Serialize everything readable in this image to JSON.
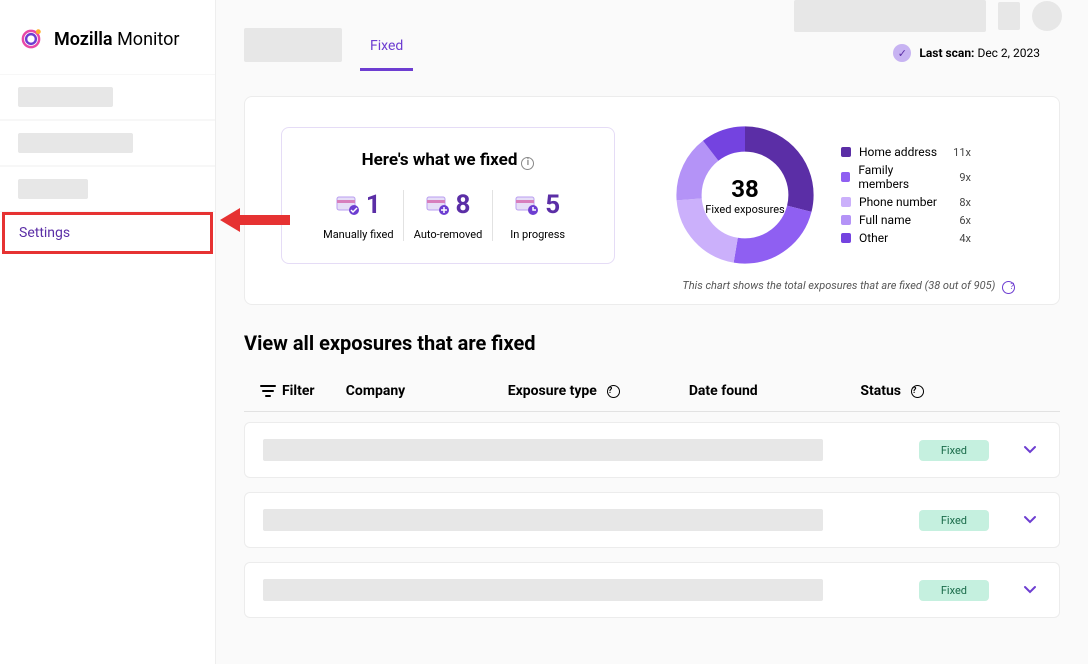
{
  "brand": {
    "name_part1": "Mozilla",
    "name_part2": "Monitor"
  },
  "sidebar": {
    "settings": "Settings"
  },
  "tabs": {
    "fixed": "Fixed"
  },
  "header": {
    "last_scan_label": "Last scan:",
    "last_scan_date": "Dec 2, 2023"
  },
  "summary": {
    "title": "Here's what we fixed",
    "stats": [
      {
        "value": "1",
        "label": "Manually fixed"
      },
      {
        "value": "8",
        "label": "Auto-removed"
      },
      {
        "value": "5",
        "label": "In progress"
      }
    ],
    "donut": {
      "value": "38",
      "label": "Fixed exposures"
    },
    "caption": "This chart shows the total exposures that are fixed (38 out of 905)"
  },
  "chart_data": {
    "type": "pie",
    "title": "Fixed exposures",
    "series": [
      {
        "name": "Home address",
        "value": 11,
        "color": "#5b2ea6"
      },
      {
        "name": "Family members",
        "value": 9,
        "color": "#8f5ff2"
      },
      {
        "name": "Phone number",
        "value": 8,
        "color": "#cbb0fb"
      },
      {
        "name": "Full name",
        "value": 6,
        "color": "#b493f7"
      },
      {
        "name": "Other",
        "value": 4,
        "color": "#7443e0"
      }
    ],
    "total": 38
  },
  "legend": [
    {
      "label": "Home address",
      "count": "11x",
      "color": "#5b2ea6"
    },
    {
      "label": "Family members",
      "count": "9x",
      "color": "#8f5ff2"
    },
    {
      "label": "Phone number",
      "count": "8x",
      "color": "#cbb0fb"
    },
    {
      "label": "Full name",
      "count": "6x",
      "color": "#b493f7"
    },
    {
      "label": "Other",
      "count": "4x",
      "color": "#7443e0"
    }
  ],
  "list": {
    "title": "View all exposures that are fixed",
    "headers": {
      "filter": "Filter",
      "company": "Company",
      "type": "Exposure type",
      "date": "Date found",
      "status": "Status"
    },
    "badge": "Fixed"
  }
}
